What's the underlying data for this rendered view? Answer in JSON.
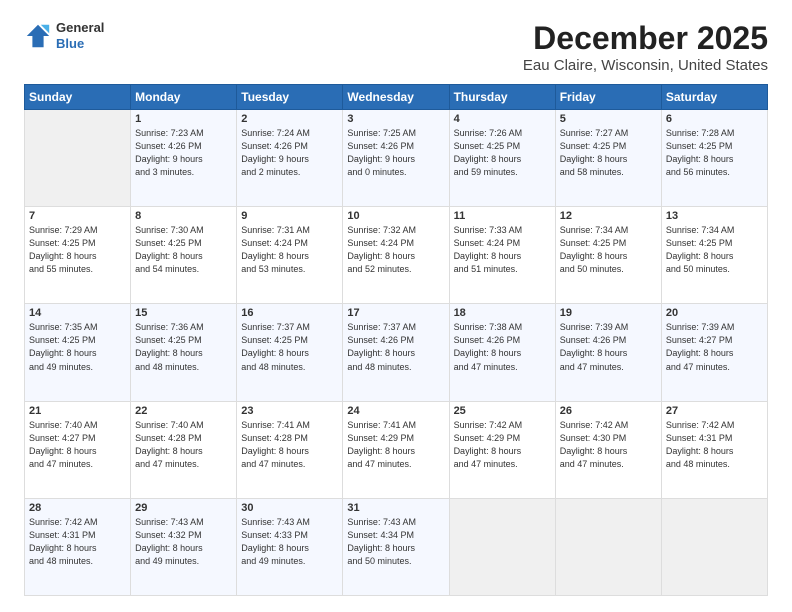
{
  "header": {
    "logo": {
      "general": "General",
      "blue": "Blue"
    },
    "title": "December 2025",
    "subtitle": "Eau Claire, Wisconsin, United States"
  },
  "calendar": {
    "days_of_week": [
      "Sunday",
      "Monday",
      "Tuesday",
      "Wednesday",
      "Thursday",
      "Friday",
      "Saturday"
    ],
    "weeks": [
      [
        {
          "day": "",
          "info": ""
        },
        {
          "day": "1",
          "info": "Sunrise: 7:23 AM\nSunset: 4:26 PM\nDaylight: 9 hours\nand 3 minutes."
        },
        {
          "day": "2",
          "info": "Sunrise: 7:24 AM\nSunset: 4:26 PM\nDaylight: 9 hours\nand 2 minutes."
        },
        {
          "day": "3",
          "info": "Sunrise: 7:25 AM\nSunset: 4:26 PM\nDaylight: 9 hours\nand 0 minutes."
        },
        {
          "day": "4",
          "info": "Sunrise: 7:26 AM\nSunset: 4:25 PM\nDaylight: 8 hours\nand 59 minutes."
        },
        {
          "day": "5",
          "info": "Sunrise: 7:27 AM\nSunset: 4:25 PM\nDaylight: 8 hours\nand 58 minutes."
        },
        {
          "day": "6",
          "info": "Sunrise: 7:28 AM\nSunset: 4:25 PM\nDaylight: 8 hours\nand 56 minutes."
        }
      ],
      [
        {
          "day": "7",
          "info": "Sunrise: 7:29 AM\nSunset: 4:25 PM\nDaylight: 8 hours\nand 55 minutes."
        },
        {
          "day": "8",
          "info": "Sunrise: 7:30 AM\nSunset: 4:25 PM\nDaylight: 8 hours\nand 54 minutes."
        },
        {
          "day": "9",
          "info": "Sunrise: 7:31 AM\nSunset: 4:24 PM\nDaylight: 8 hours\nand 53 minutes."
        },
        {
          "day": "10",
          "info": "Sunrise: 7:32 AM\nSunset: 4:24 PM\nDaylight: 8 hours\nand 52 minutes."
        },
        {
          "day": "11",
          "info": "Sunrise: 7:33 AM\nSunset: 4:24 PM\nDaylight: 8 hours\nand 51 minutes."
        },
        {
          "day": "12",
          "info": "Sunrise: 7:34 AM\nSunset: 4:25 PM\nDaylight: 8 hours\nand 50 minutes."
        },
        {
          "day": "13",
          "info": "Sunrise: 7:34 AM\nSunset: 4:25 PM\nDaylight: 8 hours\nand 50 minutes."
        }
      ],
      [
        {
          "day": "14",
          "info": "Sunrise: 7:35 AM\nSunset: 4:25 PM\nDaylight: 8 hours\nand 49 minutes."
        },
        {
          "day": "15",
          "info": "Sunrise: 7:36 AM\nSunset: 4:25 PM\nDaylight: 8 hours\nand 48 minutes."
        },
        {
          "day": "16",
          "info": "Sunrise: 7:37 AM\nSunset: 4:25 PM\nDaylight: 8 hours\nand 48 minutes."
        },
        {
          "day": "17",
          "info": "Sunrise: 7:37 AM\nSunset: 4:26 PM\nDaylight: 8 hours\nand 48 minutes."
        },
        {
          "day": "18",
          "info": "Sunrise: 7:38 AM\nSunset: 4:26 PM\nDaylight: 8 hours\nand 47 minutes."
        },
        {
          "day": "19",
          "info": "Sunrise: 7:39 AM\nSunset: 4:26 PM\nDaylight: 8 hours\nand 47 minutes."
        },
        {
          "day": "20",
          "info": "Sunrise: 7:39 AM\nSunset: 4:27 PM\nDaylight: 8 hours\nand 47 minutes."
        }
      ],
      [
        {
          "day": "21",
          "info": "Sunrise: 7:40 AM\nSunset: 4:27 PM\nDaylight: 8 hours\nand 47 minutes."
        },
        {
          "day": "22",
          "info": "Sunrise: 7:40 AM\nSunset: 4:28 PM\nDaylight: 8 hours\nand 47 minutes."
        },
        {
          "day": "23",
          "info": "Sunrise: 7:41 AM\nSunset: 4:28 PM\nDaylight: 8 hours\nand 47 minutes."
        },
        {
          "day": "24",
          "info": "Sunrise: 7:41 AM\nSunset: 4:29 PM\nDaylight: 8 hours\nand 47 minutes."
        },
        {
          "day": "25",
          "info": "Sunrise: 7:42 AM\nSunset: 4:29 PM\nDaylight: 8 hours\nand 47 minutes."
        },
        {
          "day": "26",
          "info": "Sunrise: 7:42 AM\nSunset: 4:30 PM\nDaylight: 8 hours\nand 47 minutes."
        },
        {
          "day": "27",
          "info": "Sunrise: 7:42 AM\nSunset: 4:31 PM\nDaylight: 8 hours\nand 48 minutes."
        }
      ],
      [
        {
          "day": "28",
          "info": "Sunrise: 7:42 AM\nSunset: 4:31 PM\nDaylight: 8 hours\nand 48 minutes."
        },
        {
          "day": "29",
          "info": "Sunrise: 7:43 AM\nSunset: 4:32 PM\nDaylight: 8 hours\nand 49 minutes."
        },
        {
          "day": "30",
          "info": "Sunrise: 7:43 AM\nSunset: 4:33 PM\nDaylight: 8 hours\nand 49 minutes."
        },
        {
          "day": "31",
          "info": "Sunrise: 7:43 AM\nSunset: 4:34 PM\nDaylight: 8 hours\nand 50 minutes."
        },
        {
          "day": "",
          "info": ""
        },
        {
          "day": "",
          "info": ""
        },
        {
          "day": "",
          "info": ""
        }
      ]
    ]
  }
}
